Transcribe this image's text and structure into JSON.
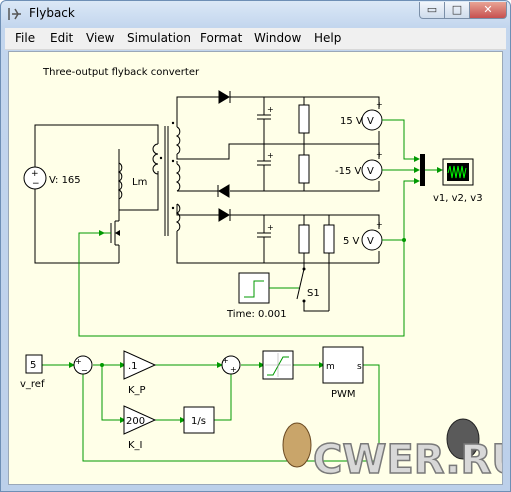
{
  "window": {
    "title": "Flyback"
  },
  "menu": [
    "File",
    "Edit",
    "View",
    "Simulation",
    "Format",
    "Window",
    "Help"
  ],
  "caption_buttons": {
    "minimize": "▭",
    "maximize": "□",
    "close": "✕"
  },
  "schematic": {
    "heading": "Three-output flyback converter",
    "source_label": "V: 165",
    "inductor_label": "Lm",
    "volt1_label": "15 V",
    "volt2_label": "-15 V",
    "volt3_label": "5 V",
    "scope_label": "v1, v2, v3",
    "step_label": "Time: 0.001",
    "switch_label": "S1",
    "ref_value": "5",
    "ref_label": "v_ref",
    "kp_value": ".1",
    "kp_label": "K_P",
    "ki_value": "200",
    "ki_label": "K_I",
    "integrator": "1/s",
    "pwm_m": "m",
    "pwm_s": "s",
    "pwm_label": "PWM",
    "sum_plus": "+",
    "sum_minus": "−",
    "meter_symbol": "V"
  },
  "watermark": "CWER.RU",
  "colors": {
    "signal": "#009900",
    "wire": "#000000",
    "canvas": "#ffffe8"
  }
}
